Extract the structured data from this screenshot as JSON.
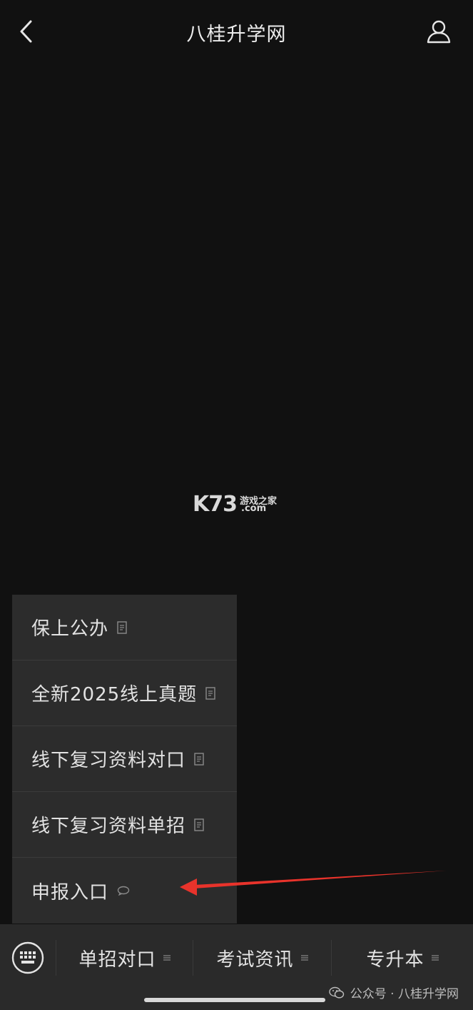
{
  "header": {
    "title": "八桂升学网"
  },
  "watermark": {
    "big": "K73",
    "small_top": "游戏之家",
    "small_bottom": ".com"
  },
  "menu": {
    "items": [
      {
        "label": "保上公办",
        "icon": "document-icon"
      },
      {
        "label": "全新2025线上真题",
        "icon": "document-icon"
      },
      {
        "label": "线下复习资料对口",
        "icon": "document-icon"
      },
      {
        "label": "线下复习资料单招",
        "icon": "document-icon"
      },
      {
        "label": "申报入口",
        "icon": "chat-bubble-icon"
      }
    ]
  },
  "bottom_tabs": [
    {
      "label": "单招对口",
      "icon": "menu-lines-icon"
    },
    {
      "label": "考试资讯",
      "icon": "menu-lines-icon"
    },
    {
      "label": "专升本",
      "icon": "menu-lines-icon"
    }
  ],
  "caption": {
    "text": "公众号 · 八桂升学网"
  },
  "colors": {
    "background": "#111111",
    "menu_bg": "#2c2c2c",
    "arrow": "#e8332b"
  }
}
